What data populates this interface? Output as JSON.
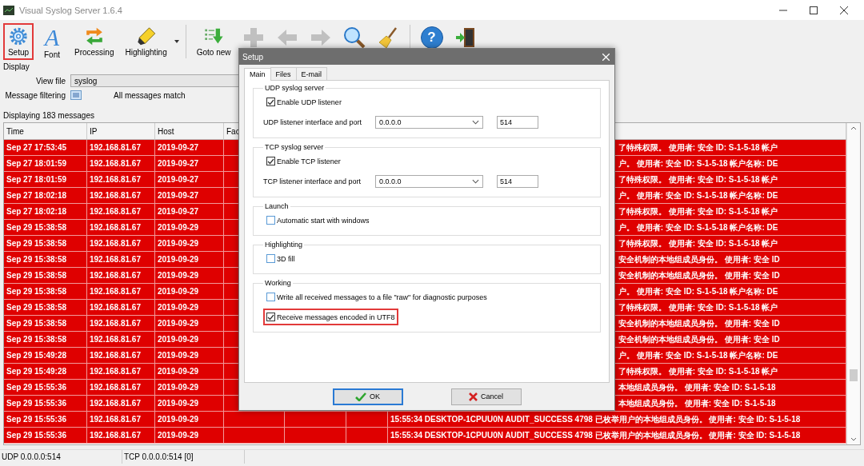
{
  "window": {
    "title": "Visual Syslog Server 1.6.4"
  },
  "toolbar": [
    [
      {
        "kind": "gear",
        "label": "Setup",
        "selected": true,
        "disabled": false
      },
      {
        "kind": "font",
        "label": "Font",
        "glyph": "A",
        "selected": false,
        "disabled": false
      },
      {
        "kind": "processing",
        "label": "Processing",
        "selected": false,
        "disabled": false
      },
      {
        "kind": "marker",
        "label": "Highlighting",
        "selected": false,
        "disabled": false
      }
    ],
    [
      {
        "kind": "goto",
        "label": "Goto new",
        "selected": false,
        "disabled": false
      },
      {
        "kind": "plus",
        "selected": false,
        "disabled": true
      },
      {
        "kind": "back",
        "selected": false,
        "disabled": true
      },
      {
        "kind": "forward",
        "selected": false,
        "disabled": true
      },
      {
        "kind": "search",
        "selected": false,
        "disabled": false
      },
      {
        "kind": "broom",
        "selected": false,
        "disabled": false
      }
    ],
    [
      {
        "kind": "help",
        "glyph": "?",
        "selected": false,
        "disabled": false
      },
      {
        "kind": "exit",
        "selected": false,
        "disabled": false
      }
    ]
  ],
  "display": {
    "heading": "Display",
    "view_file": {
      "label": "View file",
      "value": "syslog"
    },
    "filtering": {
      "label": "Message filtering",
      "status": "All messages match"
    }
  },
  "message_count": "Displaying 183 messages",
  "table": {
    "columns": [
      "Time",
      "IP",
      "Host",
      "Fac"
    ],
    "rows": [
      {
        "time": "Sep 27 17:53:45",
        "ip": "192.168.81.67",
        "host": "2019-09-27",
        "message": "了特殊权限。 使用者: 安全 ID: S-1-5-18 帐户",
        "covered": true
      },
      {
        "time": "Sep 27 18:01:59",
        "ip": "192.168.81.67",
        "host": "2019-09-27",
        "message": "户。 使用者: 安全 ID: S-1-5-18 帐户名称: DE",
        "covered": true
      },
      {
        "time": "Sep 27 18:01:59",
        "ip": "192.168.81.67",
        "host": "2019-09-27",
        "message": "了特殊权限。 使用者: 安全 ID: S-1-5-18 帐户",
        "covered": true
      },
      {
        "time": "Sep 27 18:02:18",
        "ip": "192.168.81.67",
        "host": "2019-09-27",
        "message": "户。 使用者: 安全 ID: S-1-5-18 帐户名称: DE",
        "covered": true
      },
      {
        "time": "Sep 27 18:02:18",
        "ip": "192.168.81.67",
        "host": "2019-09-27",
        "message": "了特殊权限。 使用者: 安全 ID: S-1-5-18 帐户",
        "covered": true
      },
      {
        "time": "Sep 29 15:38:58",
        "ip": "192.168.81.67",
        "host": "2019-09-29",
        "message": "户。 使用者: 安全 ID: S-1-5-18 帐户名称: DE",
        "covered": true
      },
      {
        "time": "Sep 29 15:38:58",
        "ip": "192.168.81.67",
        "host": "2019-09-29",
        "message": "了特殊权限。 使用者: 安全 ID: S-1-5-18 帐户",
        "covered": true
      },
      {
        "time": "Sep 29 15:38:58",
        "ip": "192.168.81.67",
        "host": "2019-09-29",
        "message": "安全机制的本地组成员身份。 使用者: 安全 ID",
        "covered": true
      },
      {
        "time": "Sep 29 15:38:58",
        "ip": "192.168.81.67",
        "host": "2019-09-29",
        "message": "安全机制的本地组成员身份。 使用者: 安全 ID",
        "covered": true
      },
      {
        "time": "Sep 29 15:38:58",
        "ip": "192.168.81.67",
        "host": "2019-09-29",
        "message": "户。 使用者: 安全 ID: S-1-5-18 帐户名称: DE",
        "covered": true
      },
      {
        "time": "Sep 29 15:38:58",
        "ip": "192.168.81.67",
        "host": "2019-09-29",
        "message": "了特殊权限。 使用者: 安全 ID: S-1-5-18 帐户",
        "covered": true
      },
      {
        "time": "Sep 29 15:38:58",
        "ip": "192.168.81.67",
        "host": "2019-09-29",
        "message": "安全机制的本地组成员身份。 使用者: 安全 ID",
        "covered": true
      },
      {
        "time": "Sep 29 15:38:58",
        "ip": "192.168.81.67",
        "host": "2019-09-29",
        "message": "安全机制的本地组成员身份。 使用者: 安全 ID",
        "covered": true
      },
      {
        "time": "Sep 29 15:49:28",
        "ip": "192.168.81.67",
        "host": "2019-09-29",
        "message": "户。 使用者: 安全 ID: S-1-5-18 帐户名称: DE",
        "covered": true
      },
      {
        "time": "Sep 29 15:49:28",
        "ip": "192.168.81.67",
        "host": "2019-09-29",
        "message": "了特殊权限。 使用者: 安全 ID: S-1-5-18 帐户",
        "covered": true
      },
      {
        "time": "Sep 29 15:55:36",
        "ip": "192.168.81.67",
        "host": "2019-09-29",
        "message": "本地组成员身份。 使用者: 安全 ID: S-1-5-18",
        "covered": true
      },
      {
        "time": "Sep 29 15:55:36",
        "ip": "192.168.81.67",
        "host": "2019-09-29",
        "message": "本地组成员身份。 使用者: 安全 ID: S-1-5-18",
        "covered": true
      },
      {
        "time": "Sep 29 15:55:36",
        "ip": "192.168.81.67",
        "host": "2019-09-29",
        "message": "15:55:34 DESKTOP-1CPUU0N AUDIT_SUCCESS 4798 已枚举用户的本地组成员身份。 使用者: 安全 ID: S-1-5-18",
        "covered": false
      },
      {
        "time": "Sep 29 15:55:36",
        "ip": "192.168.81.67",
        "host": "2019-09-29",
        "message": "15:55:34 DESKTOP-1CPUU0N AUDIT_SUCCESS 4798 已枚举用户的本地组成员身份。 使用者: 安全 ID: S-1-5-18",
        "covered": false
      }
    ]
  },
  "dialog": {
    "title": "Setup",
    "tabs": [
      {
        "label": "Main",
        "selected": true
      },
      {
        "label": "Files",
        "selected": false
      },
      {
        "label": "E-mail",
        "selected": false
      }
    ],
    "groups": [
      {
        "title": "UDP syslog server",
        "items": [
          {
            "kind": "checkbox",
            "label": "Enable UDP listener",
            "checked": true,
            "highlighted": false
          },
          {
            "kind": "address",
            "label": "UDP listener interface and port",
            "interface": "0.0.0.0",
            "port": "514"
          }
        ]
      },
      {
        "title": "TCP syslog server",
        "items": [
          {
            "kind": "checkbox",
            "label": "Enable TCP listener",
            "checked": true,
            "highlighted": false
          },
          {
            "kind": "address",
            "label": "TCP listener interface and port",
            "interface": "0.0.0.0",
            "port": "514"
          }
        ]
      },
      {
        "title": "Launch",
        "items": [
          {
            "kind": "checkbox",
            "label": "Automatic start with windows",
            "checked": false,
            "highlighted": false
          }
        ]
      },
      {
        "title": "Highlighting",
        "items": [
          {
            "kind": "checkbox",
            "label": "3D fill",
            "checked": false,
            "highlighted": false
          }
        ]
      },
      {
        "title": "Working",
        "items": [
          {
            "kind": "checkbox",
            "label": "Write all received messages to a file \"raw\" for diagnostic purposes",
            "checked": false,
            "highlighted": false
          },
          {
            "kind": "checkbox",
            "label": "Receive messages encoded in UTF8",
            "checked": true,
            "highlighted": true
          }
        ]
      }
    ],
    "buttons": [
      {
        "kind": "ok",
        "label": "OK"
      },
      {
        "kind": "cancel",
        "label": "Cancel"
      }
    ]
  },
  "status_bar": [
    "UDP 0.0.0.0:514",
    "TCP 0.0.0.0:514 [0]"
  ]
}
